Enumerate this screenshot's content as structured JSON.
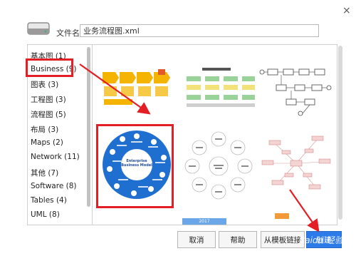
{
  "dialog": {
    "close_glyph": "×",
    "file_name_label": "文件名:",
    "file_name_value": "业务流程图.xml"
  },
  "categories": [
    {
      "label": "基本图 (1)"
    },
    {
      "label": "Business (9)"
    },
    {
      "label": "图表 (3)"
    },
    {
      "label": "工程图 (3)"
    },
    {
      "label": "流程图 (5)"
    },
    {
      "label": "布局 (3)"
    },
    {
      "label": "Maps (2)"
    },
    {
      "label": "Network (11)"
    },
    {
      "label": "其他 (7)"
    },
    {
      "label": "Software (8)"
    },
    {
      "label": "Tables (4)"
    },
    {
      "label": "UML (8)"
    }
  ],
  "selected_category": "Business (9)",
  "templates": {
    "circle_center_text": "Enterprise Business Model",
    "thumb_bottom_label": "2017"
  },
  "buttons": {
    "cancel": "取消",
    "help": "帮助",
    "from_link": "从模板链接",
    "create": "创建"
  },
  "watermark": "Baidu 经验",
  "colors": {
    "accent_blue": "#2d7be8",
    "highlight_red": "#e31e24",
    "circle_blue": "#1f6fd1"
  }
}
